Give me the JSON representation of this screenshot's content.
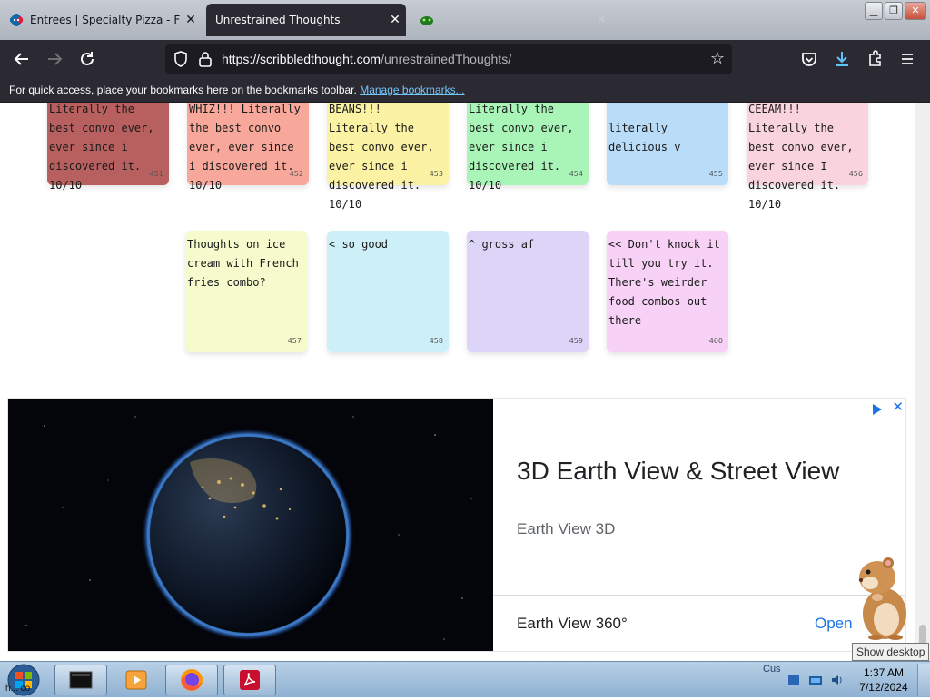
{
  "browser": {
    "tabs": [
      {
        "title": "Entrees | Specialty Pizza - Find a",
        "active": false
      },
      {
        "title": "Unrestrained Thoughts",
        "active": true
      },
      {
        "title": "",
        "active": false
      }
    ],
    "url_host": "https://scribbledthought.com",
    "url_path": "/unrestrainedThoughts/",
    "bookmarks_text": "For quick access, place your bookmarks here on the bookmarks toolbar.",
    "bookmarks_link": "Manage bookmarks..."
  },
  "notes_row1": [
    {
      "text": "Literally the best convo ever, ever since i discovered it. 10/10",
      "num": "451",
      "color": "#b8605f"
    },
    {
      "text": "WHIZ!!! Literally the best convo ever, ever since i discovered it. 10/10",
      "num": "452",
      "color": "#f8a89a"
    },
    {
      "text": "BEANS!!! Literally the best convo ever, ever since i discovered it. 10/10",
      "num": "453",
      "color": "#fbf3a3"
    },
    {
      "text": "Literally the best convo ever, ever since i discovered it. 10/10",
      "num": "454",
      "color": "#a9f5b8"
    },
    {
      "text": "literally delicious v",
      "num": "455",
      "color": "#b9dcf8"
    },
    {
      "text": "CEEAM!!! Literally the best convo ever, ever since I discovered it. 10/10",
      "num": "456",
      "color": "#f9d4dc"
    }
  ],
  "notes_row2": [
    {
      "text": "Thoughts on ice cream with French fries combo?",
      "num": "457",
      "color": "#f5fbcc"
    },
    {
      "text": "< so good",
      "num": "458",
      "color": "#cdf0f8"
    },
    {
      "text": "^ gross af",
      "num": "459",
      "color": "#ddd5f8"
    },
    {
      "text": "<< Don't knock it till you try it. There's weirder food combos out there",
      "num": "460",
      "color": "#f8d2f6"
    }
  ],
  "ad": {
    "headline": "3D Earth View & Street View",
    "subtitle": "Earth View 3D",
    "footer_title": "Earth View 360°",
    "cta": "Open",
    "close": "✕"
  },
  "tooltip": "Show desktop",
  "taskbar": {
    "clock_time": "1:37 AM",
    "clock_date": "7/12/2024",
    "tray_label": "Cus",
    "left_label": "h... co"
  }
}
